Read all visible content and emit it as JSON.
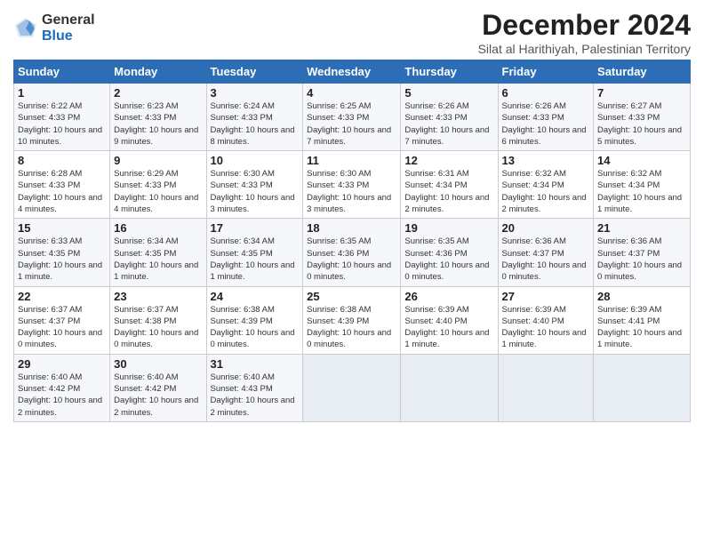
{
  "header": {
    "logo_general": "General",
    "logo_blue": "Blue",
    "title": "December 2024",
    "subtitle": "Silat al Harithiyah, Palestinian Territory"
  },
  "weekdays": [
    "Sunday",
    "Monday",
    "Tuesday",
    "Wednesday",
    "Thursday",
    "Friday",
    "Saturday"
  ],
  "weeks": [
    [
      {
        "day": "1",
        "sunrise": "6:22 AM",
        "sunset": "4:33 PM",
        "daylight": "10 hours and 10 minutes."
      },
      {
        "day": "2",
        "sunrise": "6:23 AM",
        "sunset": "4:33 PM",
        "daylight": "10 hours and 9 minutes."
      },
      {
        "day": "3",
        "sunrise": "6:24 AM",
        "sunset": "4:33 PM",
        "daylight": "10 hours and 8 minutes."
      },
      {
        "day": "4",
        "sunrise": "6:25 AM",
        "sunset": "4:33 PM",
        "daylight": "10 hours and 7 minutes."
      },
      {
        "day": "5",
        "sunrise": "6:26 AM",
        "sunset": "4:33 PM",
        "daylight": "10 hours and 7 minutes."
      },
      {
        "day": "6",
        "sunrise": "6:26 AM",
        "sunset": "4:33 PM",
        "daylight": "10 hours and 6 minutes."
      },
      {
        "day": "7",
        "sunrise": "6:27 AM",
        "sunset": "4:33 PM",
        "daylight": "10 hours and 5 minutes."
      }
    ],
    [
      {
        "day": "8",
        "sunrise": "6:28 AM",
        "sunset": "4:33 PM",
        "daylight": "10 hours and 4 minutes."
      },
      {
        "day": "9",
        "sunrise": "6:29 AM",
        "sunset": "4:33 PM",
        "daylight": "10 hours and 4 minutes."
      },
      {
        "day": "10",
        "sunrise": "6:30 AM",
        "sunset": "4:33 PM",
        "daylight": "10 hours and 3 minutes."
      },
      {
        "day": "11",
        "sunrise": "6:30 AM",
        "sunset": "4:33 PM",
        "daylight": "10 hours and 3 minutes."
      },
      {
        "day": "12",
        "sunrise": "6:31 AM",
        "sunset": "4:34 PM",
        "daylight": "10 hours and 2 minutes."
      },
      {
        "day": "13",
        "sunrise": "6:32 AM",
        "sunset": "4:34 PM",
        "daylight": "10 hours and 2 minutes."
      },
      {
        "day": "14",
        "sunrise": "6:32 AM",
        "sunset": "4:34 PM",
        "daylight": "10 hours and 1 minute."
      }
    ],
    [
      {
        "day": "15",
        "sunrise": "6:33 AM",
        "sunset": "4:35 PM",
        "daylight": "10 hours and 1 minute."
      },
      {
        "day": "16",
        "sunrise": "6:34 AM",
        "sunset": "4:35 PM",
        "daylight": "10 hours and 1 minute."
      },
      {
        "day": "17",
        "sunrise": "6:34 AM",
        "sunset": "4:35 PM",
        "daylight": "10 hours and 1 minute."
      },
      {
        "day": "18",
        "sunrise": "6:35 AM",
        "sunset": "4:36 PM",
        "daylight": "10 hours and 0 minutes."
      },
      {
        "day": "19",
        "sunrise": "6:35 AM",
        "sunset": "4:36 PM",
        "daylight": "10 hours and 0 minutes."
      },
      {
        "day": "20",
        "sunrise": "6:36 AM",
        "sunset": "4:37 PM",
        "daylight": "10 hours and 0 minutes."
      },
      {
        "day": "21",
        "sunrise": "6:36 AM",
        "sunset": "4:37 PM",
        "daylight": "10 hours and 0 minutes."
      }
    ],
    [
      {
        "day": "22",
        "sunrise": "6:37 AM",
        "sunset": "4:37 PM",
        "daylight": "10 hours and 0 minutes."
      },
      {
        "day": "23",
        "sunrise": "6:37 AM",
        "sunset": "4:38 PM",
        "daylight": "10 hours and 0 minutes."
      },
      {
        "day": "24",
        "sunrise": "6:38 AM",
        "sunset": "4:39 PM",
        "daylight": "10 hours and 0 minutes."
      },
      {
        "day": "25",
        "sunrise": "6:38 AM",
        "sunset": "4:39 PM",
        "daylight": "10 hours and 0 minutes."
      },
      {
        "day": "26",
        "sunrise": "6:39 AM",
        "sunset": "4:40 PM",
        "daylight": "10 hours and 1 minute."
      },
      {
        "day": "27",
        "sunrise": "6:39 AM",
        "sunset": "4:40 PM",
        "daylight": "10 hours and 1 minute."
      },
      {
        "day": "28",
        "sunrise": "6:39 AM",
        "sunset": "4:41 PM",
        "daylight": "10 hours and 1 minute."
      }
    ],
    [
      {
        "day": "29",
        "sunrise": "6:40 AM",
        "sunset": "4:42 PM",
        "daylight": "10 hours and 2 minutes."
      },
      {
        "day": "30",
        "sunrise": "6:40 AM",
        "sunset": "4:42 PM",
        "daylight": "10 hours and 2 minutes."
      },
      {
        "day": "31",
        "sunrise": "6:40 AM",
        "sunset": "4:43 PM",
        "daylight": "10 hours and 2 minutes."
      },
      null,
      null,
      null,
      null
    ]
  ]
}
